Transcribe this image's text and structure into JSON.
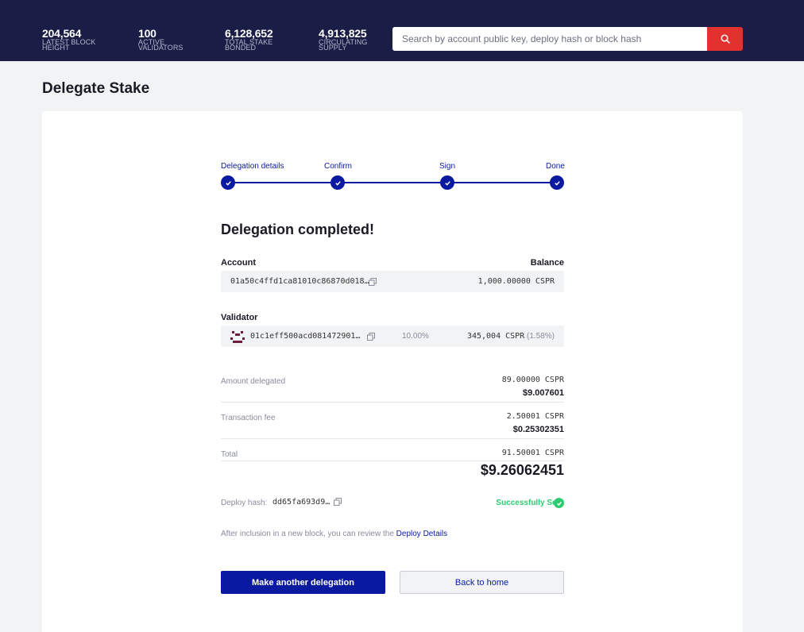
{
  "stats": [
    {
      "value": "204,564",
      "label": "LATEST BLOCK HEIGHT"
    },
    {
      "value": "100",
      "label": "ACTIVE VALIDATORS"
    },
    {
      "value": "6,128,652",
      "label": "TOTAL STAKE BONDED"
    },
    {
      "value": "4,913,825",
      "label": "CIRCULATING SUPPLY"
    }
  ],
  "search": {
    "placeholder": "Search by account public key, deploy hash or block hash"
  },
  "page_title": "Delegate Stake",
  "steps": [
    "Delegation details",
    "Confirm",
    "Sign",
    "Done"
  ],
  "heading": "Delegation completed!",
  "account": {
    "label": "Account",
    "balance_label": "Balance",
    "key": "01a50c4ffd1ca81010c86870d018…",
    "balance": "1,000.00000 CSPR"
  },
  "validator": {
    "label": "Validator",
    "key": "01c1eff500acd081472901…",
    "commission": "10.00%",
    "stake": "345,004 CSPR",
    "stake_share": "(1.58%)"
  },
  "summary": {
    "amount": {
      "label": "Amount delegated",
      "cspr": "89.00000 CSPR",
      "usd": "$9.007601"
    },
    "fee": {
      "label": "Transaction fee",
      "cspr": "2.50001 CSPR",
      "usd": "$0.25302351"
    },
    "total": {
      "label": "Total",
      "cspr": "91.50001 CSPR",
      "usd": "$9.26062451"
    }
  },
  "deploy": {
    "label": "Deploy hash:",
    "hash": "dd65fa693d9…",
    "status": "Successfully Sent"
  },
  "note": {
    "text": "After inclusion in a new block, you can review the ",
    "link": "Deploy Details"
  },
  "buttons": {
    "primary": "Make another delegation",
    "secondary": "Back to home"
  },
  "colors": {
    "navy": "#1a1e46",
    "accent": "#0a1aa0",
    "search_button": "#e2312f",
    "success": "#2ecc71"
  }
}
